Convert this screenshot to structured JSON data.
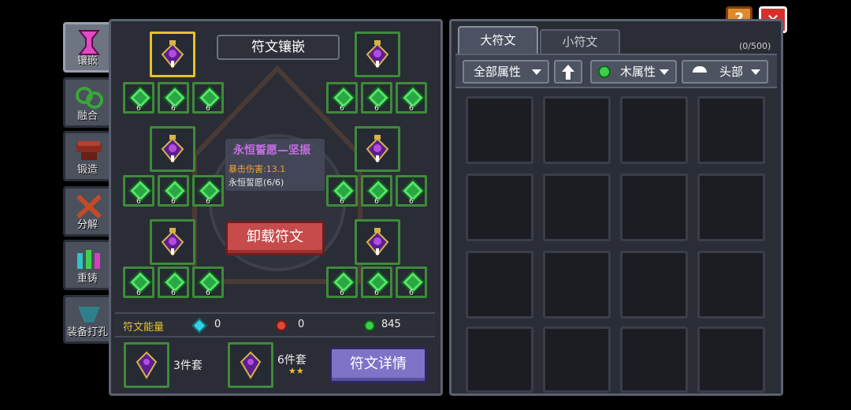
{
  "side_tabs": [
    {
      "label": "镶嵌",
      "icon": "inlay-icon",
      "active": true
    },
    {
      "label": "融合",
      "icon": "fusion-icon",
      "active": false
    },
    {
      "label": "锻造",
      "icon": "forge-icon",
      "active": false
    },
    {
      "label": "分解",
      "icon": "decompose-icon",
      "active": false
    },
    {
      "label": "重铸",
      "icon": "recast-icon",
      "active": false
    },
    {
      "label": "装备打孔",
      "icon": "socket-drill-icon",
      "active": false
    }
  ],
  "inlay_panel": {
    "title": "符文镶嵌",
    "big_slot_levels": [
      "6",
      "6",
      "6",
      "6",
      "6",
      "6",
      "6",
      "6",
      "6",
      "6",
      "6",
      "6",
      "6",
      "6",
      "6",
      "6",
      "6",
      "6"
    ],
    "tooltip": {
      "name": "永恒誓愿—坚振",
      "stat": "暴击伤害:13.1",
      "set": "永恒誓愿(6/6)"
    },
    "unequip_button": "卸载符文",
    "energy": {
      "label": "符文能量",
      "cyan": "0",
      "red": "0",
      "green": "845"
    },
    "sets": [
      {
        "label": "3件套"
      },
      {
        "label": "6件套",
        "stars": "★★"
      }
    ],
    "details_button": "符文详情"
  },
  "inventory": {
    "tabs": [
      {
        "label": "大符文",
        "active": true
      },
      {
        "label": "小符文",
        "active": false
      }
    ],
    "count": "(0/500)",
    "filters": {
      "attribute": "全部属性",
      "element": "木属性",
      "slot": "头部"
    },
    "sort_icon": "arrow-up-icon"
  },
  "top_buttons": {
    "help": "?",
    "close": "✕"
  },
  "colors": {
    "panel": "#343845",
    "slot_border": "#3f8a3a",
    "accent_gold": "#e5c12a",
    "rune_purple": "#5a1f8f"
  }
}
